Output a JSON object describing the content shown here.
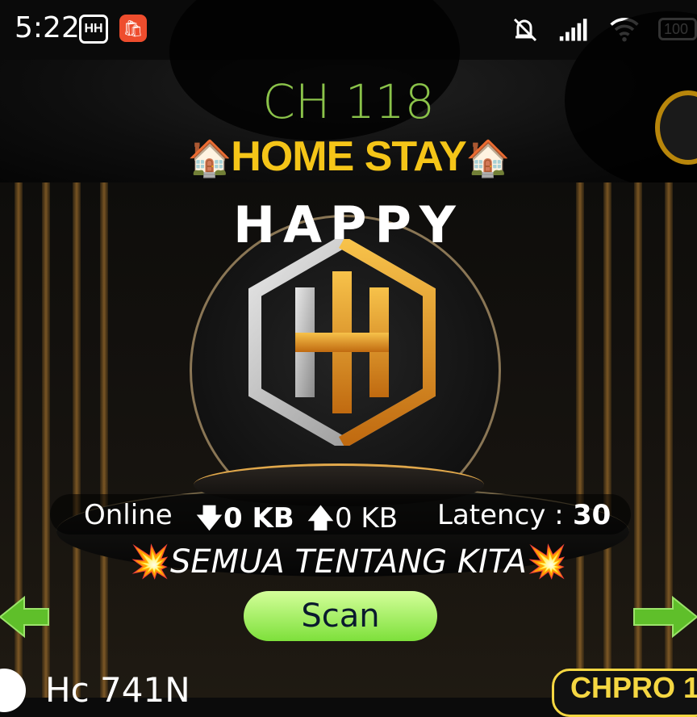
{
  "status_bar": {
    "time": "5:22",
    "app_icon_text": "HH",
    "battery": "100"
  },
  "header": {
    "channel": "CH 118",
    "home_stay": "HOME STAY",
    "house_emoji": "🏠"
  },
  "banner": {
    "title": "HAPPY",
    "logo_text": "HH"
  },
  "stats": {
    "online_label": "Online",
    "download": "0 KB",
    "upload": "0 KB",
    "latency_label": "Latency :",
    "latency_value": "30"
  },
  "slogan": {
    "text": "SEMUA TENTANG KITA",
    "burst_emoji": "💥"
  },
  "actions": {
    "scan_label": "Scan"
  },
  "bottom": {
    "device_name": "Hc 741N",
    "badge": "CHPRO 1"
  },
  "colors": {
    "channel_green": "#8bc34a",
    "title_gold": "#f5c518",
    "scan_green": "#7ee03b",
    "badge_yellow": "#f5d742"
  }
}
